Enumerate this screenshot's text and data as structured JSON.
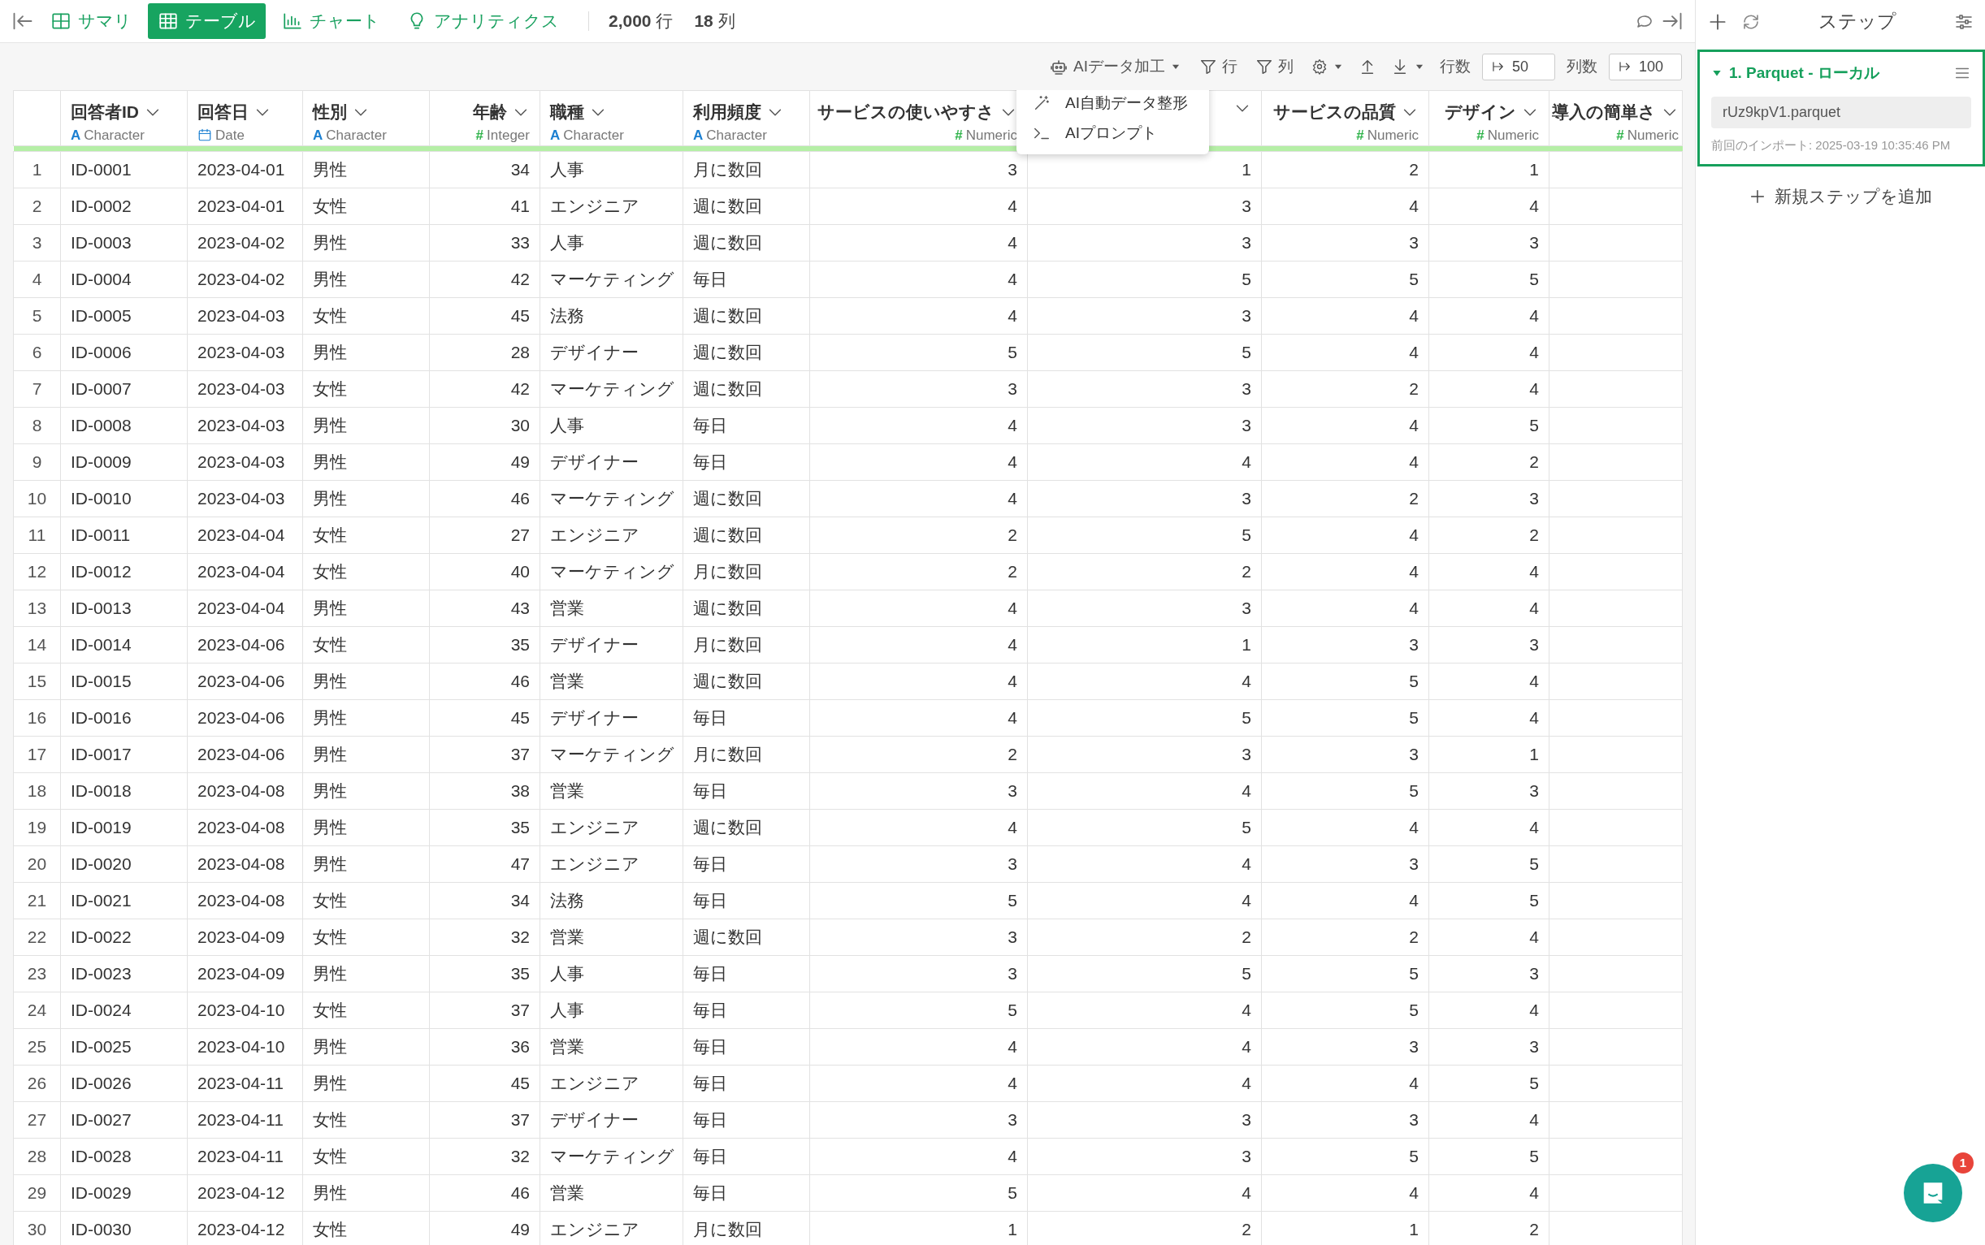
{
  "tabs": [
    {
      "label": "サマリ",
      "kind": "summary",
      "selected": false
    },
    {
      "label": "テーブル",
      "kind": "table",
      "selected": true
    },
    {
      "label": "チャート",
      "kind": "chart",
      "selected": false
    },
    {
      "label": "アナリティクス",
      "kind": "analytics",
      "selected": false
    }
  ],
  "counts": [
    {
      "value": "2,000",
      "unit": "行"
    },
    {
      "value": "18",
      "unit": "列"
    }
  ],
  "toolbar": {
    "ai_button": "AIデータ加工",
    "row_filter": "行",
    "column_filter": "列",
    "rows_label": "行数",
    "rows_value": "50",
    "columns_label": "列数",
    "columns_value": "100"
  },
  "ai_menu": [
    {
      "label": "AI自動データ整形",
      "kind": "auto"
    },
    {
      "label": "AIプロンプト",
      "kind": "prompt"
    }
  ],
  "table": {
    "columns": [
      {
        "name": "回答者ID",
        "kind": "text",
        "glyph": "A",
        "type": "Character"
      },
      {
        "name": "回答日",
        "kind": "date",
        "type": "Date"
      },
      {
        "name": "性別",
        "kind": "text",
        "glyph": "A",
        "type": "Character"
      },
      {
        "name": "年齢",
        "kind": "number",
        "glyph": "#",
        "type": "Integer"
      },
      {
        "name": "職種",
        "kind": "text",
        "glyph": "A",
        "type": "Character"
      },
      {
        "name": "利用頻度",
        "kind": "text",
        "glyph": "A",
        "type": "Character"
      },
      {
        "name": "サービスの使いやすさ",
        "kind": "number",
        "glyph": "#",
        "type": "Numeric"
      },
      {
        "kind": "number"
      },
      {
        "name": "サービスの品質",
        "kind": "number",
        "glyph": "#",
        "type": "Numeric"
      },
      {
        "name": "デザイン",
        "kind": "number",
        "glyph": "#",
        "type": "Numeric"
      },
      {
        "name": "導入の簡単さ",
        "kind": "number",
        "glyph": "#",
        "type": "Numeric"
      }
    ],
    "rows": [
      {
        "number": "1",
        "cells": [
          "ID-0001",
          "2023-04-01",
          "男性",
          "34",
          "人事",
          "月に数回",
          "3",
          "1",
          "2",
          "1"
        ]
      },
      {
        "number": "2",
        "cells": [
          "ID-0002",
          "2023-04-01",
          "女性",
          "41",
          "エンジニア",
          "週に数回",
          "4",
          "3",
          "4",
          "4"
        ]
      },
      {
        "number": "3",
        "cells": [
          "ID-0003",
          "2023-04-02",
          "男性",
          "33",
          "人事",
          "週に数回",
          "4",
          "3",
          "3",
          "3"
        ]
      },
      {
        "number": "4",
        "cells": [
          "ID-0004",
          "2023-04-02",
          "男性",
          "42",
          "マーケティング",
          "毎日",
          "4",
          "5",
          "5",
          "5"
        ]
      },
      {
        "number": "5",
        "cells": [
          "ID-0005",
          "2023-04-03",
          "女性",
          "45",
          "法務",
          "週に数回",
          "4",
          "3",
          "4",
          "4"
        ]
      },
      {
        "number": "6",
        "cells": [
          "ID-0006",
          "2023-04-03",
          "男性",
          "28",
          "デザイナー",
          "週に数回",
          "5",
          "5",
          "4",
          "4"
        ]
      },
      {
        "number": "7",
        "cells": [
          "ID-0007",
          "2023-04-03",
          "女性",
          "42",
          "マーケティング",
          "週に数回",
          "3",
          "3",
          "2",
          "4"
        ]
      },
      {
        "number": "8",
        "cells": [
          "ID-0008",
          "2023-04-03",
          "男性",
          "30",
          "人事",
          "毎日",
          "4",
          "3",
          "4",
          "5"
        ]
      },
      {
        "number": "9",
        "cells": [
          "ID-0009",
          "2023-04-03",
          "男性",
          "49",
          "デザイナー",
          "毎日",
          "4",
          "4",
          "4",
          "2"
        ]
      },
      {
        "number": "10",
        "cells": [
          "ID-0010",
          "2023-04-03",
          "男性",
          "46",
          "マーケティング",
          "週に数回",
          "4",
          "3",
          "2",
          "3"
        ]
      },
      {
        "number": "11",
        "cells": [
          "ID-0011",
          "2023-04-04",
          "女性",
          "27",
          "エンジニア",
          "週に数回",
          "2",
          "5",
          "4",
          "2"
        ]
      },
      {
        "number": "12",
        "cells": [
          "ID-0012",
          "2023-04-04",
          "女性",
          "40",
          "マーケティング",
          "月に数回",
          "2",
          "2",
          "4",
          "4"
        ]
      },
      {
        "number": "13",
        "cells": [
          "ID-0013",
          "2023-04-04",
          "男性",
          "43",
          "営業",
          "週に数回",
          "4",
          "3",
          "4",
          "4"
        ]
      },
      {
        "number": "14",
        "cells": [
          "ID-0014",
          "2023-04-06",
          "女性",
          "35",
          "デザイナー",
          "月に数回",
          "4",
          "1",
          "3",
          "3"
        ]
      },
      {
        "number": "15",
        "cells": [
          "ID-0015",
          "2023-04-06",
          "男性",
          "46",
          "営業",
          "週に数回",
          "4",
          "4",
          "5",
          "4"
        ]
      },
      {
        "number": "16",
        "cells": [
          "ID-0016",
          "2023-04-06",
          "男性",
          "45",
          "デザイナー",
          "毎日",
          "4",
          "5",
          "5",
          "4"
        ]
      },
      {
        "number": "17",
        "cells": [
          "ID-0017",
          "2023-04-06",
          "男性",
          "37",
          "マーケティング",
          "月に数回",
          "2",
          "3",
          "3",
          "1"
        ]
      },
      {
        "number": "18",
        "cells": [
          "ID-0018",
          "2023-04-08",
          "男性",
          "38",
          "営業",
          "毎日",
          "3",
          "4",
          "5",
          "3"
        ]
      },
      {
        "number": "19",
        "cells": [
          "ID-0019",
          "2023-04-08",
          "男性",
          "35",
          "エンジニア",
          "週に数回",
          "4",
          "5",
          "4",
          "4"
        ]
      },
      {
        "number": "20",
        "cells": [
          "ID-0020",
          "2023-04-08",
          "男性",
          "47",
          "エンジニア",
          "毎日",
          "3",
          "4",
          "3",
          "5"
        ]
      },
      {
        "number": "21",
        "cells": [
          "ID-0021",
          "2023-04-08",
          "女性",
          "34",
          "法務",
          "毎日",
          "5",
          "4",
          "4",
          "5"
        ]
      },
      {
        "number": "22",
        "cells": [
          "ID-0022",
          "2023-04-09",
          "女性",
          "32",
          "営業",
          "週に数回",
          "3",
          "2",
          "2",
          "4"
        ]
      },
      {
        "number": "23",
        "cells": [
          "ID-0023",
          "2023-04-09",
          "男性",
          "35",
          "人事",
          "毎日",
          "3",
          "5",
          "5",
          "3"
        ]
      },
      {
        "number": "24",
        "cells": [
          "ID-0024",
          "2023-04-10",
          "女性",
          "37",
          "人事",
          "毎日",
          "5",
          "4",
          "5",
          "4"
        ]
      },
      {
        "number": "25",
        "cells": [
          "ID-0025",
          "2023-04-10",
          "男性",
          "36",
          "営業",
          "毎日",
          "4",
          "4",
          "3",
          "3"
        ]
      },
      {
        "number": "26",
        "cells": [
          "ID-0026",
          "2023-04-11",
          "男性",
          "45",
          "エンジニア",
          "毎日",
          "4",
          "4",
          "4",
          "5"
        ]
      },
      {
        "number": "27",
        "cells": [
          "ID-0027",
          "2023-04-11",
          "女性",
          "37",
          "デザイナー",
          "毎日",
          "3",
          "3",
          "3",
          "4"
        ]
      },
      {
        "number": "28",
        "cells": [
          "ID-0028",
          "2023-04-11",
          "女性",
          "32",
          "マーケティング",
          "毎日",
          "4",
          "3",
          "5",
          "5"
        ]
      },
      {
        "number": "29",
        "cells": [
          "ID-0029",
          "2023-04-12",
          "男性",
          "46",
          "営業",
          "毎日",
          "5",
          "4",
          "4",
          "4"
        ]
      },
      {
        "number": "30",
        "cells": [
          "ID-0030",
          "2023-04-12",
          "女性",
          "49",
          "エンジニア",
          "月に数回",
          "1",
          "2",
          "1",
          "2"
        ]
      }
    ]
  },
  "sidebar": {
    "title": "ステップ",
    "steps": [
      {
        "title": "1. Parquet - ローカル",
        "expanded": true,
        "file": "rUz9kpV1.parquet",
        "note": "前回のインポート: 2025-03-19 10:35:46 PM"
      }
    ],
    "add_step": "新規ステップを追加"
  },
  "chat": {
    "badge": "1"
  }
}
